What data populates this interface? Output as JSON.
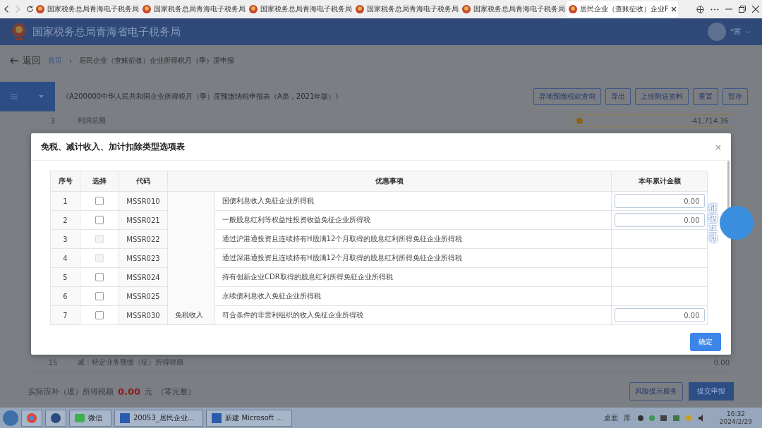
{
  "browser_tabs": [
    {
      "title": "国家税务总局青海电子税务局",
      "selected": false
    },
    {
      "title": "国家税务总局青海电子税务局",
      "selected": false
    },
    {
      "title": "国家税务总局青海电子税务局",
      "selected": false
    },
    {
      "title": "国家税务总局青海电子税务局",
      "selected": false
    },
    {
      "title": "国家税务总局青海电子税务局",
      "selected": false
    },
    {
      "title": "居民企业（查账征收）企业F",
      "selected": true
    }
  ],
  "header": {
    "title": "国家税务总局青海省电子税务局",
    "user": "*茜"
  },
  "breadcrumb": {
    "back": "返回",
    "separator": "›",
    "items": [
      "首页",
      "居民企业（查账征收）企业所得税月（季）度申报"
    ]
  },
  "toolbar": {
    "form_title": "《A200000中华人民共和国企业所得税月（季）度预缴纳税申报表（A类，2021年版）》",
    "buttons": [
      "异地预缴税款查询",
      "导出",
      "上传附送资料",
      "重置",
      "暂存"
    ]
  },
  "background_rows": [
    {
      "no": "3",
      "label": "利润总额",
      "value": "-41,714.36",
      "warning": true
    },
    {
      "no": "15",
      "label": "减：特定业务预缴（征）所得税额",
      "value": "0.00",
      "warning": false
    }
  ],
  "footer": {
    "label": "实际应补（退）所得税额",
    "amount": "0.00",
    "unit": "元",
    "words": "（零元整）",
    "buttons": [
      "风险提示服务",
      "提交申报"
    ]
  },
  "dialog": {
    "title": "免税、减计收入、加计扣除类型选项表",
    "columns": [
      "序号",
      "选择",
      "代码",
      "优惠事项",
      "本年累计金额"
    ],
    "category": "免税收入",
    "confirm": "确定",
    "rows": [
      {
        "no": "1",
        "checked": false,
        "disabled": false,
        "code": "MSSR010",
        "item": "国债利息收入免征企业所得税",
        "amount": "0.00"
      },
      {
        "no": "2",
        "checked": false,
        "disabled": false,
        "code": "MSSR021",
        "item": "一般股息红利等权益性投资收益免征企业所得税",
        "amount": "0.00"
      },
      {
        "no": "3",
        "checked": false,
        "disabled": true,
        "code": "MSSR022",
        "item": "通过沪港通投资且连续持有H股满12个月取得的股息红利所得免征企业所得税"
      },
      {
        "no": "4",
        "checked": false,
        "disabled": true,
        "code": "MSSR023",
        "item": "通过深港通投资且连续持有H股满12个月取得的股息红利所得免征企业所得税"
      },
      {
        "no": "5",
        "checked": false,
        "disabled": false,
        "code": "MSSR024",
        "item": "持有创新企业CDR取得的股息红利所得免征企业所得税"
      },
      {
        "no": "6",
        "checked": false,
        "disabled": false,
        "code": "MSSR025",
        "item": "永续债利息收入免征企业所得税"
      },
      {
        "no": "7",
        "checked": false,
        "disabled": false,
        "code": "MSSR030",
        "item": "符合条件的非营利组织的收入免征企业所得税",
        "amount": "0.00"
      }
    ]
  },
  "mascot": {
    "label": "征纳互动"
  },
  "taskbar": {
    "items": [
      {
        "kind": "browser"
      },
      {
        "kind": "app"
      },
      {
        "kind": "chat",
        "label": "微信"
      },
      {
        "kind": "word",
        "label": "20053_居民企业..."
      },
      {
        "kind": "word",
        "label": "新建 Microsoft ..."
      }
    ],
    "tray": [
      "桌面",
      "库"
    ],
    "time": "16:32",
    "date": "2024/2/29"
  }
}
